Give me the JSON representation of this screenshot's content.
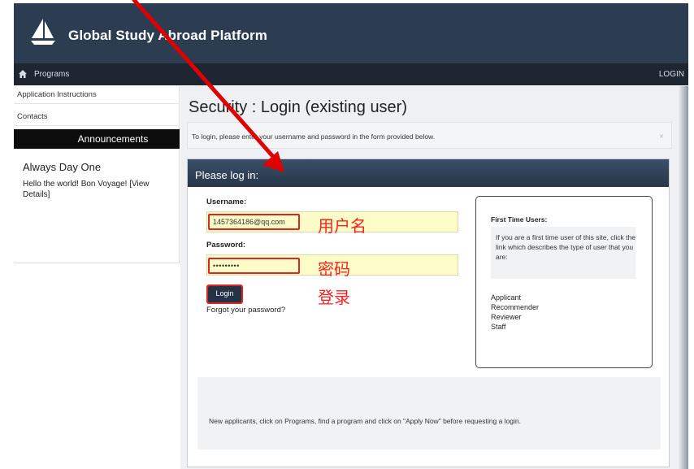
{
  "header": {
    "app_title": "Global Study Abroad Platform",
    "logo_icon": "sailboat-icon"
  },
  "navbar": {
    "home_icon": "home-icon",
    "programs_label": "Programs",
    "login_label": "LOGIN"
  },
  "sidebar": {
    "links": [
      "Application Instructions",
      "Contacts"
    ],
    "announcements_header": "Announcements",
    "announcement": {
      "title": "Always Day One",
      "text": "Hello the world! Bon Voyage!",
      "link": "[View Details]"
    }
  },
  "main": {
    "page_title": "Security : Login (existing user)",
    "info_message": "To login, please enter your username and password in the form provided below.",
    "info_close": "×"
  },
  "login_panel": {
    "title": "Please log in:",
    "username_label": "Username:",
    "username_value": "1457364186@qq.com",
    "password_label": "Password:",
    "password_value": "•••••••••",
    "login_button": "Login",
    "forgot_link": "Forgot your password?"
  },
  "annotations": {
    "username_hint": "用户名",
    "password_hint": "密码",
    "login_hint": "登录",
    "arrow_color": "#e00000"
  },
  "first_time": {
    "title": "First Time Users:",
    "note": "If you are a first time user of this site, click the link which describes the type of user that you are:",
    "user_types": [
      "Applicant",
      "Recommender",
      "Reviewer",
      "Staff"
    ]
  },
  "footer_note": "New applicants, click on Programs, find a program and click on \"Apply Now\" before requesting a login.",
  "colors": {
    "header_bg": "#2c3d52",
    "navbar_bg": "#1e2632",
    "highlight_red": "#e02424",
    "field_bg": "#fbfcc7"
  }
}
